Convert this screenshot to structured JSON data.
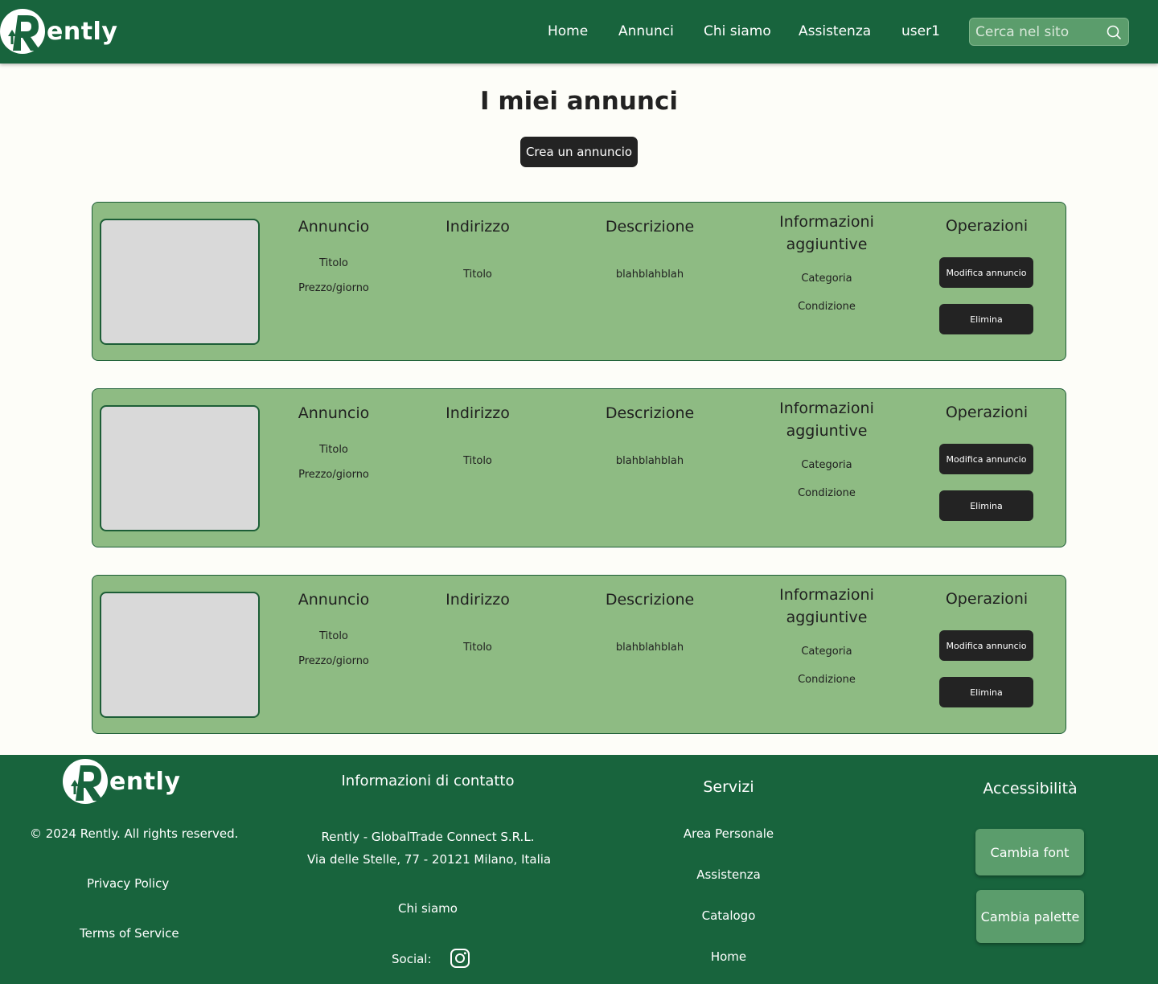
{
  "colors": {
    "header_bg": "#18643d",
    "card_bg": "#8ebb83",
    "button_dark": "#232323",
    "footer_btn": "#5b9d6c"
  },
  "header": {
    "logo_text": "ently",
    "nav": [
      "Home",
      "Annunci",
      "Chi siamo",
      "Assistenza",
      "user1"
    ],
    "search_placeholder": "Cerca nel sito",
    "search_icon": "search-icon"
  },
  "main": {
    "title": "I miei annunci",
    "create_button": "Crea un annuncio",
    "listings": [
      {
        "annuncio": {
          "head": "Annuncio",
          "titolo": "Titolo",
          "prezzo": "Prezzo/giorno"
        },
        "indirizzo": {
          "head": "Indirizzo",
          "value": "Titolo"
        },
        "descrizione": {
          "head": "Descrizione",
          "value": "blahblahblah"
        },
        "info": {
          "head_line1": "Informazioni",
          "head_line2": "aggiuntive",
          "categoria": "Categoria",
          "condizione": "Condizione"
        },
        "operazioni": {
          "head": "Operazioni",
          "modifica": "Modifica annuncio",
          "elimina": "Elimina"
        }
      },
      {
        "annuncio": {
          "head": "Annuncio",
          "titolo": "Titolo",
          "prezzo": "Prezzo/giorno"
        },
        "indirizzo": {
          "head": "Indirizzo",
          "value": "Titolo"
        },
        "descrizione": {
          "head": "Descrizione",
          "value": "blahblahblah"
        },
        "info": {
          "head_line1": "Informazioni",
          "head_line2": "aggiuntive",
          "categoria": "Categoria",
          "condizione": "Condizione"
        },
        "operazioni": {
          "head": "Operazioni",
          "modifica": "Modifica annuncio",
          "elimina": "Elimina"
        }
      },
      {
        "annuncio": {
          "head": "Annuncio",
          "titolo": "Titolo",
          "prezzo": "Prezzo/giorno"
        },
        "indirizzo": {
          "head": "Indirizzo",
          "value": "Titolo"
        },
        "descrizione": {
          "head": "Descrizione",
          "value": "blahblahblah"
        },
        "info": {
          "head_line1": "Informazioni",
          "head_line2": "aggiuntive",
          "categoria": "Categoria",
          "condizione": "Condizione"
        },
        "operazioni": {
          "head": "Operazioni",
          "modifica": "Modifica annuncio",
          "elimina": "Elimina"
        }
      }
    ]
  },
  "footer": {
    "logo_text": "ently",
    "copyright": "© 2024 Rently. All rights reserved.",
    "privacy": "Privacy Policy",
    "terms": "Terms of Service",
    "contact": {
      "title": "Informazioni di contatto",
      "company": "Rently - GlobalTrade Connect S.R.L.",
      "address": "Via delle Stelle, 77 - 20121 Milano, Italia",
      "about": "Chi siamo",
      "social_label": "Social:",
      "social_icon": "instagram-icon"
    },
    "services": {
      "title": "Servizi",
      "items": [
        "Area Personale",
        "Assistenza",
        "Catalogo",
        "Home"
      ]
    },
    "accessibility": {
      "title": "Accessibilità",
      "font_button": "Cambia font",
      "palette_button": "Cambia palette"
    }
  }
}
